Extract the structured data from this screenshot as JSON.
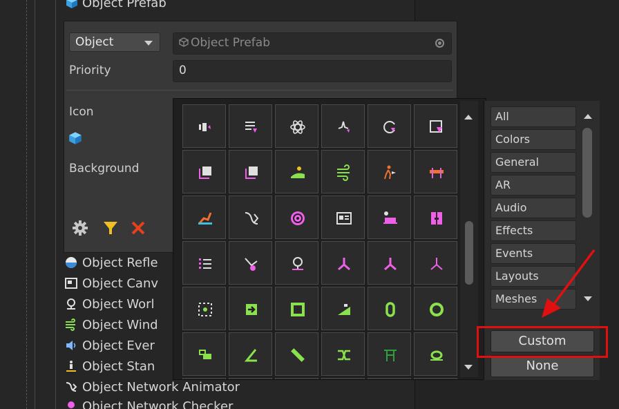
{
  "header": {
    "title": "Object Prefab"
  },
  "inspector": {
    "type_dropdown": "Object",
    "object_field_placeholder": "Object Prefab",
    "priority_label": "Priority",
    "priority_value": "0",
    "icon_label": "Icon",
    "background_label": "Background"
  },
  "tree_items": [
    {
      "label": "Object Refle",
      "icon": "sphere-icon"
    },
    {
      "label": "Object Canv",
      "icon": "canvas-icon"
    },
    {
      "label": "Object Worl",
      "icon": "location-icon"
    },
    {
      "label": "Object Wind",
      "icon": "wind-icon"
    },
    {
      "label": "Object Ever",
      "icon": "speaker-icon"
    },
    {
      "label": "Object Stan",
      "icon": "standing-person-icon"
    },
    {
      "label": "Object Network Animator",
      "icon": "animator-icon"
    },
    {
      "label": "Object Network Checker",
      "icon": "pin-icon"
    }
  ],
  "categories": [
    "All",
    "Colors",
    "General",
    "AR",
    "Audio",
    "Effects",
    "Events",
    "Layouts",
    "Meshes"
  ],
  "buttons": {
    "custom": "Custom",
    "none": "None"
  },
  "colors": {
    "accent_green": "#8be04e",
    "accent_pink": "#ef5fe8",
    "highlight_red": "#e01010"
  }
}
